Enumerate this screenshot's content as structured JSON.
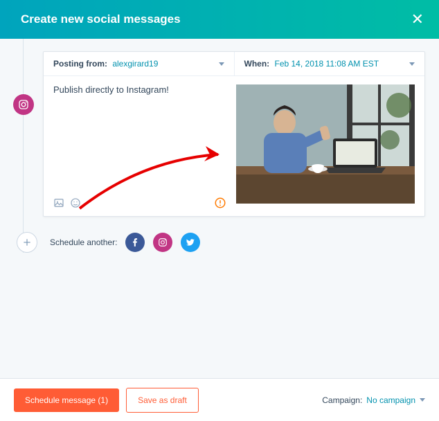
{
  "header": {
    "title": "Create new social messages"
  },
  "composer": {
    "posting_from_label": "Posting from:",
    "posting_from_value": "alexgirard19",
    "when_label": "When:",
    "when_value": "Feb 14, 2018 11:08 AM EST",
    "message": "Publish directly to Instagram!"
  },
  "schedule": {
    "label": "Schedule another:"
  },
  "footer": {
    "schedule_btn": "Schedule message (1)",
    "draft_btn": "Save as draft",
    "campaign_label": "Campaign:",
    "campaign_value": "No campaign"
  }
}
